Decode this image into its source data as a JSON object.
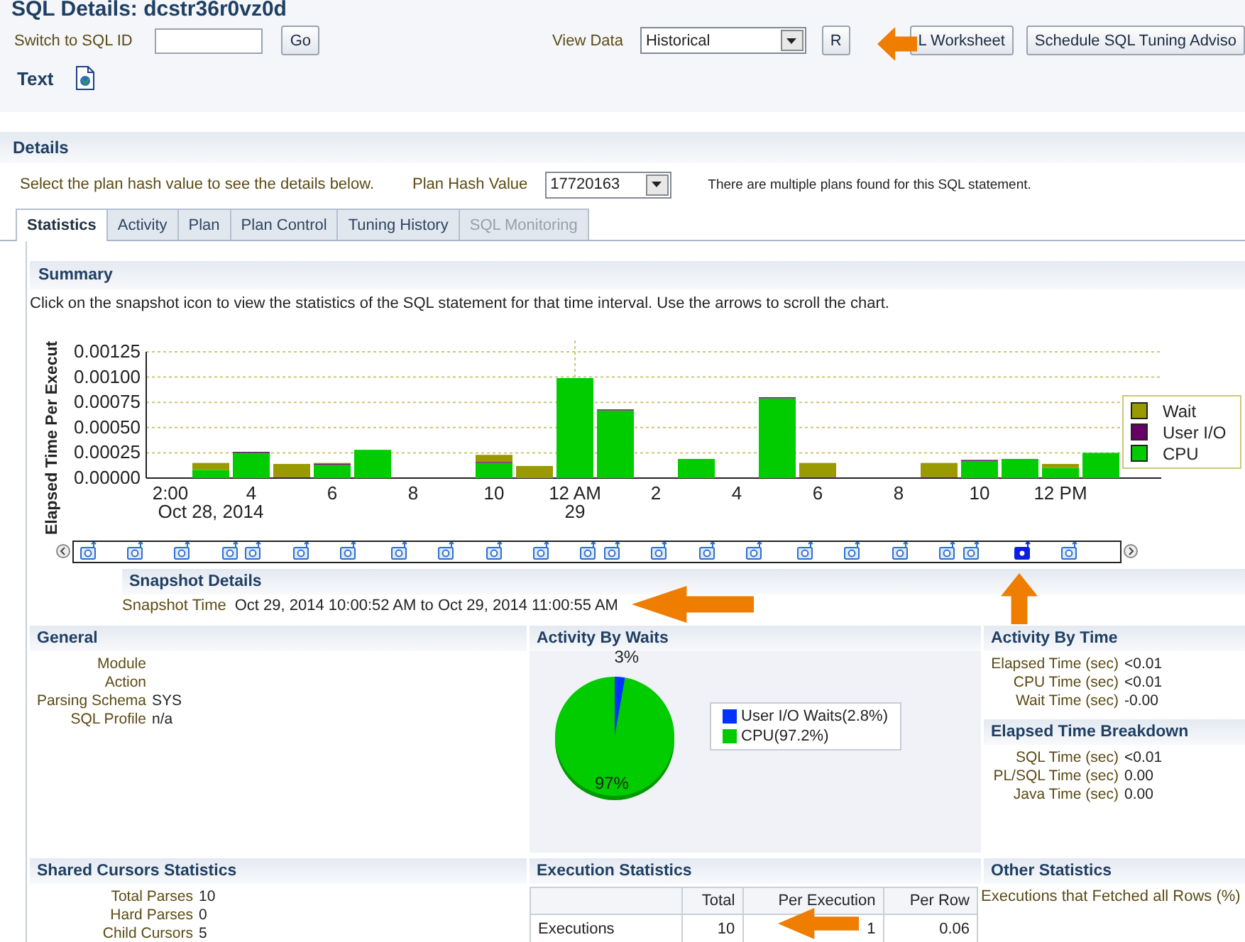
{
  "title": "SQL Details: dcstr36r0vz0d",
  "switch": {
    "label": "Switch to SQL ID",
    "button": "Go"
  },
  "view_data": {
    "label": "View Data",
    "value": "Historical"
  },
  "toolbar_buttons": [
    "R",
    "L Worksheet",
    "Schedule SQL Tuning Adviso"
  ],
  "text_tab": {
    "label": "Text"
  },
  "details": {
    "title": "Details",
    "hint": "Select the plan hash value to see the details below.",
    "plan_label": "Plan Hash Value",
    "plan_value": "17720163",
    "note": "There are multiple plans found for this SQL statement."
  },
  "tabs": [
    {
      "label": "Statistics",
      "selected": true,
      "disabled": false
    },
    {
      "label": "Activity",
      "selected": false,
      "disabled": false
    },
    {
      "label": "Plan",
      "selected": false,
      "disabled": false
    },
    {
      "label": "Plan Control",
      "selected": false,
      "disabled": false
    },
    {
      "label": "Tuning History",
      "selected": false,
      "disabled": false
    },
    {
      "label": "SQL Monitoring",
      "selected": false,
      "disabled": true
    }
  ],
  "summary": {
    "title": "Summary",
    "hint": "Click on the snapshot icon to view the statistics of the SQL statement for that time interval. Use the arrows to scroll the chart.",
    "chart_data": {
      "type": "bar",
      "stacked": true,
      "ylabel": "Elapsed Time Per Execut",
      "categories": [
        "2:00",
        null,
        "4",
        null,
        "6",
        null,
        "8",
        null,
        "10",
        null,
        "12 AM",
        null,
        "2",
        null,
        "4",
        null,
        "6",
        null,
        "8",
        null,
        "10",
        null,
        "12 PM",
        null
      ],
      "annotations": [
        "Oct 28, 2014",
        "29"
      ],
      "grid": true,
      "legend": true,
      "ylim": [
        0,
        0.00125
      ],
      "yticks": [
        {
          "value": 0,
          "label": "0.00000"
        },
        {
          "value": 0.00025,
          "label": "0.00025"
        },
        {
          "value": 0.0005,
          "label": "0.00050"
        },
        {
          "value": 0.00075,
          "label": "0.00075"
        },
        {
          "value": 0.001,
          "label": "0.00100"
        },
        {
          "value": 0.00125,
          "label": "0.00125"
        }
      ],
      "series": [
        {
          "name": "CPU",
          "color": "#00cc00",
          "values": [
            null,
            8e-05,
            0.00025,
            0,
            0.00013,
            0.00028,
            null,
            null,
            0.00015,
            0,
            0.00099,
            0.00067,
            null,
            0.00019,
            null,
            0.00079,
            0,
            null,
            null,
            0,
            0.00017,
            0.00019,
            0.0001,
            0.00025
          ]
        },
        {
          "name": "User I/O",
          "color": "#660066",
          "values": [
            null,
            0,
            1e-05,
            1e-05,
            1e-05,
            0,
            null,
            null,
            1e-05,
            0,
            0,
            1e-05,
            null,
            0,
            null,
            1e-05,
            1e-05,
            null,
            null,
            1e-05,
            1e-05,
            0,
            0,
            0
          ]
        },
        {
          "name": "Wait",
          "color": "#999900",
          "values": [
            null,
            7e-05,
            0,
            0.00013,
            1e-05,
            0,
            null,
            null,
            7e-05,
            0.00012,
            0,
            0,
            null,
            0,
            null,
            0,
            0.00014,
            null,
            null,
            0.00014,
            0,
            0,
            4e-05,
            0
          ]
        }
      ]
    },
    "snapshots": [
      {
        "selected": false
      },
      {
        "selected": false
      },
      {
        "selected": false
      },
      {
        "selected": false
      },
      {
        "selected": false
      },
      {
        "selected": false
      },
      {
        "selected": false
      },
      {
        "selected": false
      },
      {
        "selected": false
      },
      {
        "selected": false
      },
      {
        "selected": false
      },
      {
        "selected": false
      },
      {
        "selected": false
      },
      {
        "selected": false
      },
      {
        "selected": false
      },
      {
        "selected": false
      },
      {
        "selected": false
      },
      {
        "selected": false
      },
      {
        "selected": false
      },
      {
        "selected": false
      },
      {
        "selected": false
      },
      {
        "selected": true
      },
      {
        "selected": false
      }
    ]
  },
  "snapshot_details": {
    "title": "Snapshot Details",
    "label": "Snapshot Time",
    "value": "Oct 29, 2014 10:00:52 AM to Oct 29, 2014 11:00:55 AM"
  },
  "general": {
    "title": "General",
    "rows": [
      {
        "label": "Module",
        "value": ""
      },
      {
        "label": "Action",
        "value": ""
      },
      {
        "label": "Parsing Schema",
        "value": "SYS"
      },
      {
        "label": "SQL Profile",
        "value": "n/a"
      }
    ]
  },
  "activity_by_waits": {
    "title": "Activity By Waits",
    "chart_data": {
      "type": "pie",
      "categories": [
        "User I/O Waits(2.8%)",
        "CPU(97.2%)"
      ],
      "series": [
        {
          "values": [
            2.8,
            97.2
          ]
        }
      ],
      "colors": [
        "#0033ff",
        "#00cc00"
      ],
      "value_labels": [
        "3%",
        "97%"
      ]
    }
  },
  "activity_by_time": {
    "title": "Activity By Time",
    "rows": [
      {
        "label": "Elapsed Time (sec)",
        "value": "<0.01"
      },
      {
        "label": "CPU Time (sec)",
        "value": "<0.01"
      },
      {
        "label": "Wait Time (sec)",
        "value": "-0.00"
      }
    ]
  },
  "elapsed_breakdown": {
    "title": "Elapsed Time Breakdown",
    "rows": [
      {
        "label": "SQL Time (sec)",
        "value": "<0.01"
      },
      {
        "label": "PL/SQL Time (sec)",
        "value": "0.00"
      },
      {
        "label": "Java Time (sec)",
        "value": "0.00"
      }
    ]
  },
  "shared_cursors": {
    "title": "Shared Cursors Statistics",
    "rows": [
      {
        "label": "Total Parses",
        "value": "10"
      },
      {
        "label": "Hard Parses",
        "value": "0"
      },
      {
        "label": "Child Cursors",
        "value": "5"
      }
    ]
  },
  "execution_stats": {
    "title": "Execution Statistics",
    "columns": [
      "Total",
      "Per Execution",
      "Per Row"
    ],
    "rows": [
      {
        "label": "Executions",
        "values": [
          "10",
          "1",
          "0.06"
        ]
      }
    ]
  },
  "other_stats": {
    "title": "Other Statistics",
    "rows": [
      {
        "label": "Executions that Fetched all Rows (%)"
      }
    ]
  }
}
